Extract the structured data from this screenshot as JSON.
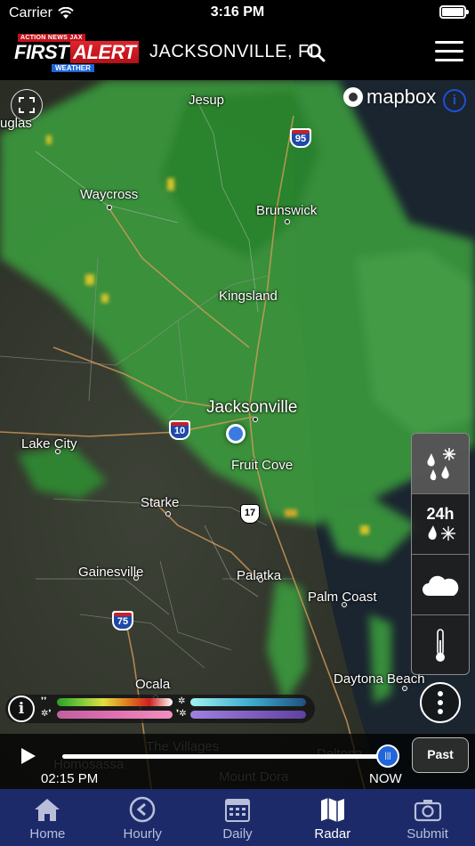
{
  "status_bar": {
    "carrier": "Carrier",
    "time": "3:16 PM"
  },
  "header": {
    "logo": {
      "top": "ACTION NEWS JAX",
      "first": "FIRST",
      "alert": "ALERT",
      "sub": "WEATHER"
    },
    "location": "JACKSONVILLE, FL"
  },
  "map": {
    "attribution": "mapbox",
    "cities": [
      {
        "name": "Jesup"
      },
      {
        "name": "uglas"
      },
      {
        "name": "Waycross"
      },
      {
        "name": "Brunswick"
      },
      {
        "name": "Kingsland"
      },
      {
        "name": "Jacksonville"
      },
      {
        "name": "Lake City"
      },
      {
        "name": "Fruit Cove"
      },
      {
        "name": "Starke"
      },
      {
        "name": "Gainesville"
      },
      {
        "name": "Palatka"
      },
      {
        "name": "Palm Coast"
      },
      {
        "name": "Ocala"
      },
      {
        "name": "Daytona Beach"
      },
      {
        "name": "The Villages"
      },
      {
        "name": "Homosassa"
      },
      {
        "name": "Mount Dora"
      },
      {
        "name": "Deltona"
      }
    ],
    "highways": [
      {
        "label": "95",
        "kind": "interstate"
      },
      {
        "label": "10",
        "kind": "interstate"
      },
      {
        "label": "17",
        "kind": "us"
      },
      {
        "label": "75",
        "kind": "interstate"
      }
    ]
  },
  "layers": [
    {
      "name": "radar",
      "label": ""
    },
    {
      "name": "24h-precip",
      "label": "24h"
    },
    {
      "name": "clouds",
      "label": ""
    },
    {
      "name": "temperature",
      "label": ""
    }
  ],
  "timeline": {
    "start_time": "02:15 PM",
    "end_label": "NOW",
    "past_button": "Past",
    "progress": 0.97
  },
  "tabs": [
    {
      "label": "Home",
      "icon": "home-icon"
    },
    {
      "label": "Hourly",
      "icon": "clock-icon"
    },
    {
      "label": "Daily",
      "icon": "calendar-icon"
    },
    {
      "label": "Radar",
      "icon": "map-icon"
    },
    {
      "label": "Submit",
      "icon": "camera-icon"
    }
  ],
  "colors": {
    "tab_bar": "#1c2a6a",
    "accent": "#2265d9",
    "radar_green": "#3a9a3a"
  }
}
